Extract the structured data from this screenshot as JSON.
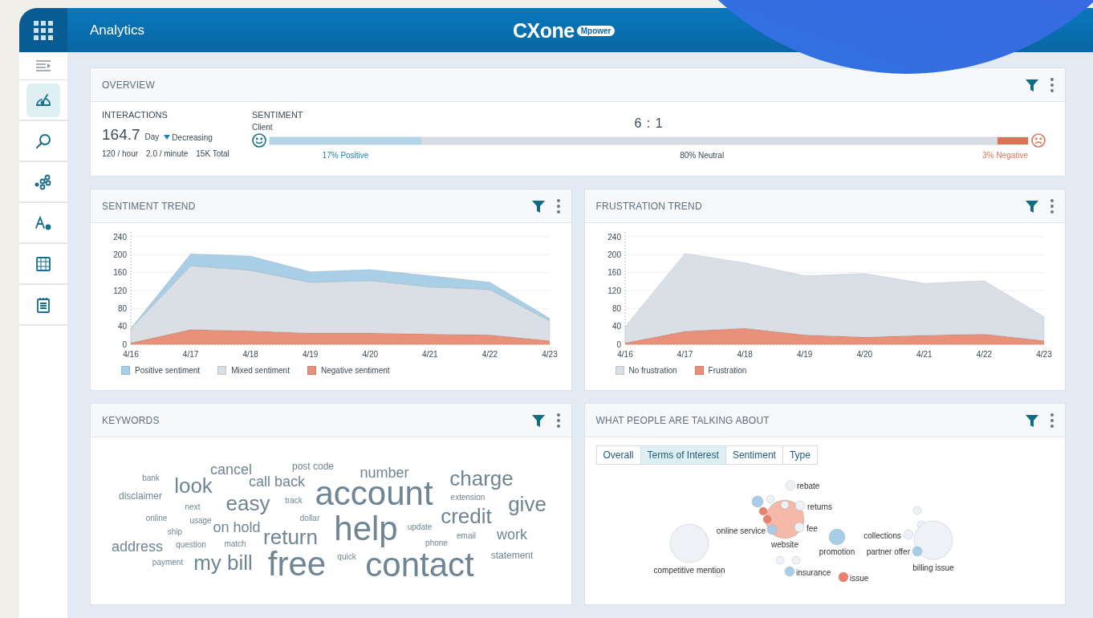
{
  "header": {
    "title": "Analytics",
    "logo": "CXone",
    "logo_badge": "Mpower"
  },
  "nav_items": [
    {
      "selected": true
    },
    {
      "selected": false
    },
    {
      "selected": false
    },
    {
      "selected": false
    },
    {
      "selected": false
    },
    {
      "selected": false
    }
  ],
  "overview": {
    "title": "OVERVIEW",
    "interactions": {
      "label": "INTERACTIONS",
      "value": "164.7",
      "period": "Day",
      "trend": "Decreasing",
      "stats": [
        "120 / hour",
        "2.0 / minute",
        "15K Total"
      ]
    },
    "sentiment": {
      "label": "SENTIMENT",
      "source": "Client",
      "ratio": "6 : 1",
      "segments": [
        {
          "kind": "positive",
          "level": 0.2,
          "label": "17% Positive"
        },
        {
          "kind": "neutral",
          "label": "80% Neutral"
        },
        {
          "kind": "negative",
          "level": 0.04,
          "label": "3% Negative"
        }
      ]
    }
  },
  "sentiment_trend": {
    "title": "SENTIMENT TREND",
    "chart_data": {
      "type": "area",
      "stacked": true,
      "grid": true,
      "categories": [
        "4/16",
        "4/17",
        "4/18",
        "4/19",
        "4/20",
        "4/21",
        "4/22",
        "4/23"
      ],
      "ylim": [
        0,
        240
      ],
      "yticks": [
        0,
        40,
        80,
        120,
        160,
        200,
        240
      ],
      "series": [
        {
          "name": "Positive sentiment",
          "color": "#a9cfe6",
          "values": [
            1,
            27,
            32,
            24,
            25,
            25,
            17,
            6
          ]
        },
        {
          "name": "Mixed sentiment",
          "color": "#d9dfe4",
          "values": [
            32,
            142,
            135,
            113,
            117,
            105,
            101,
            44
          ]
        },
        {
          "name": "Negative sentiment",
          "color": "#e8907a",
          "values": [
            3,
            33,
            30,
            25,
            25,
            23,
            21,
            8
          ]
        }
      ]
    }
  },
  "frustration_trend": {
    "title": "FRUSTRATION TREND",
    "chart_data": {
      "type": "area",
      "stacked": true,
      "grid": true,
      "categories": [
        "4/16",
        "4/17",
        "4/18",
        "4/19",
        "4/20",
        "4/21",
        "4/22",
        "4/23"
      ],
      "ylim": [
        0,
        240
      ],
      "yticks": [
        0,
        40,
        80,
        120,
        160,
        200,
        240
      ],
      "series": [
        {
          "name": "No frustration",
          "color": "#d9dfe4",
          "values": [
            37,
            174,
            146,
            132,
            142,
            116,
            119,
            54
          ]
        },
        {
          "name": "Frustration",
          "color": "#e8907a",
          "values": [
            3,
            29,
            36,
            21,
            16,
            20,
            23,
            8
          ]
        }
      ]
    }
  },
  "keywords": {
    "title": "KEYWORDS",
    "words": [
      {
        "text": "bank",
        "kind": "xs"
      },
      {
        "text": "look",
        "kind": "l"
      },
      {
        "text": "cancel",
        "kind": "m"
      },
      {
        "text": "call back",
        "kind": "m"
      },
      {
        "text": "post code",
        "kind": "s"
      },
      {
        "text": "number",
        "kind": "m"
      },
      {
        "text": "charge",
        "kind": "l"
      },
      {
        "text": "disclaimer",
        "kind": "s"
      },
      {
        "text": "next",
        "kind": "xs"
      },
      {
        "text": "easy",
        "kind": "l"
      },
      {
        "text": "track",
        "kind": "xs"
      },
      {
        "text": "account",
        "kind": "xl"
      },
      {
        "text": "extension",
        "kind": "xs"
      },
      {
        "text": "give",
        "kind": "l"
      },
      {
        "text": "online",
        "kind": "xs"
      },
      {
        "text": "ship",
        "kind": "xs"
      },
      {
        "text": "usage",
        "kind": "xs"
      },
      {
        "text": "on hold",
        "kind": "m"
      },
      {
        "text": "dollar",
        "kind": "xs"
      },
      {
        "text": "return",
        "kind": "l"
      },
      {
        "text": "help",
        "kind": "xl"
      },
      {
        "text": "update",
        "kind": "xs"
      },
      {
        "text": "credit",
        "kind": "l"
      },
      {
        "text": "email",
        "kind": "xs"
      },
      {
        "text": "work",
        "kind": "m"
      },
      {
        "text": "address",
        "kind": "m"
      },
      {
        "text": "payment",
        "kind": "xs"
      },
      {
        "text": "question",
        "kind": "xs"
      },
      {
        "text": "match",
        "kind": "xs"
      },
      {
        "text": "my bill",
        "kind": "l"
      },
      {
        "text": "free",
        "kind": "xl"
      },
      {
        "text": "quick",
        "kind": "xs"
      },
      {
        "text": "phone",
        "kind": "xs"
      },
      {
        "text": "contact",
        "kind": "xl"
      },
      {
        "text": "statement",
        "kind": "s"
      }
    ]
  },
  "talking_about": {
    "title": "WHAT PEOPLE ARE TALKING ABOUT",
    "tabs": [
      {
        "label": "Overall",
        "selected": false
      },
      {
        "label": "Terms of Interest",
        "selected": true
      },
      {
        "label": "Sentiment",
        "selected": false
      },
      {
        "label": "Type",
        "selected": false
      }
    ],
    "bubbles": [
      {
        "label": "rebate",
        "color": "#eef1f5"
      },
      {
        "color": "#a8cde6"
      },
      {
        "color": "#eef1f5"
      },
      {
        "label": "website",
        "color": "#f4b9a8"
      },
      {
        "color": "#eef1f5"
      },
      {
        "label": "returns",
        "color": "#eef1f5"
      },
      {
        "color": "#e8826b"
      },
      {
        "color": "#e8826b"
      },
      {
        "label": "online service",
        "color": "#a8cde6"
      },
      {
        "label": "fee",
        "color": "#eef1f5"
      },
      {
        "label": "competitive mention",
        "color": "#eef1f5"
      },
      {
        "color": "#eef1f5"
      },
      {
        "label": "promotion",
        "color": "#a8cde6"
      },
      {
        "color": "#eef1f5"
      },
      {
        "color": "#eef1f5"
      },
      {
        "label": "insurance",
        "color": "#a8cde6"
      },
      {
        "label": "issue",
        "color": "#e8826b"
      },
      {
        "color": "#eef1f5"
      },
      {
        "color": "#eef1f5"
      },
      {
        "label": "billing issue",
        "color": "#eef1f5"
      },
      {
        "label": "collections",
        "color": "#eef1f5"
      },
      {
        "label": "partner offer",
        "color": "#a8cde6"
      }
    ]
  }
}
